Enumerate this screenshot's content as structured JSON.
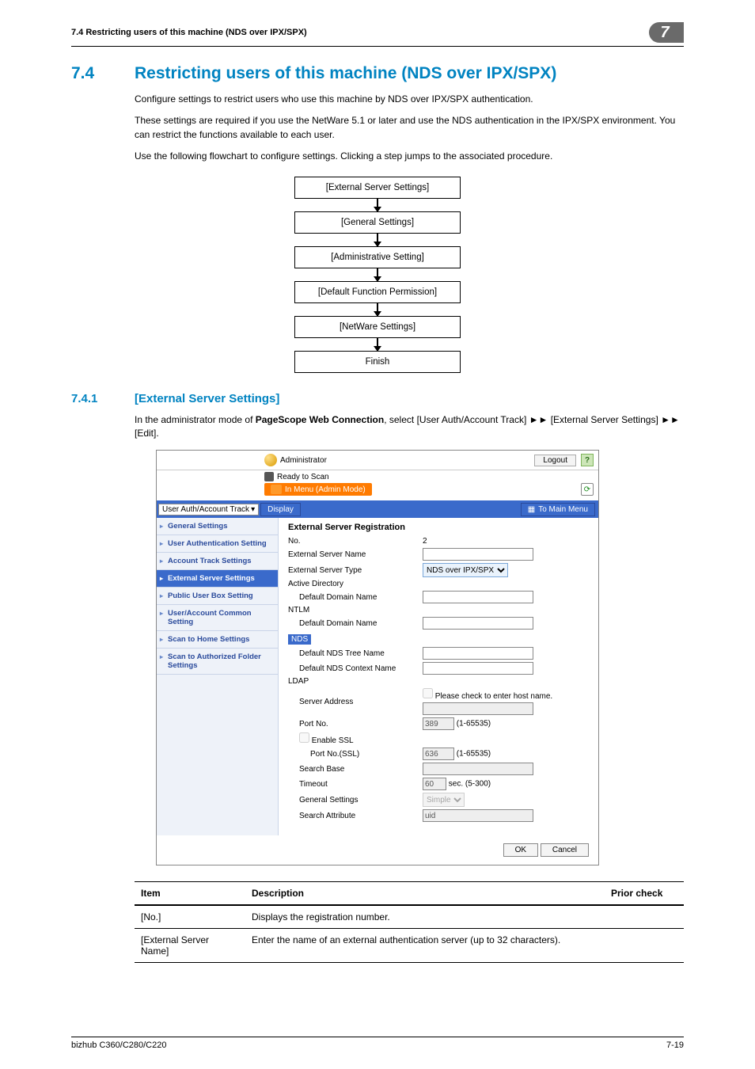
{
  "header": {
    "running": "7.4      Restricting users of this machine (NDS over IPX/SPX)",
    "chapter_badge": "7"
  },
  "title": {
    "num": "7.4",
    "text": "Restricting users of this machine (NDS over IPX/SPX)"
  },
  "paragraphs": {
    "p1": "Configure settings to restrict users who use this machine by NDS over IPX/SPX authentication.",
    "p2": "These settings are required if you use the NetWare 5.1 or later and use the NDS authentication in the IPX/SPX environment. You can restrict the functions available to each user.",
    "p3": "Use the following flowchart to configure settings. Clicking a step jumps to the associated procedure."
  },
  "flow": {
    "b1": "[External Server Settings]",
    "b2": "[General Settings]",
    "b3": "[Administrative Setting]",
    "b4": "[Default Function Permission]",
    "b5": "[NetWare Settings]",
    "b6": "Finish"
  },
  "subtitle": {
    "num": "7.4.1",
    "text": "[External Server Settings]"
  },
  "sub_p_prefix": "In the administrator mode of ",
  "sub_p_bold": "PageScope Web Connection",
  "sub_p_suffix": ", select [User Auth/Account Track] ►► [External Server Settings] ►► [Edit].",
  "screenshot": {
    "admin_label": "Administrator",
    "logout": "Logout",
    "ready": "Ready to Scan",
    "menu_mode": "In Menu (Admin Mode)",
    "dropdown": "User Auth/Account Track",
    "display_btn": "Display",
    "to_main": "To Main Menu",
    "side": {
      "s1": "General Settings",
      "s2": "User Authentication Setting",
      "s3": "Account Track Settings",
      "s4": "External Server Settings",
      "s5": "Public User Box Setting",
      "s6": "User/Account Common Setting",
      "s7": "Scan to Home Settings",
      "s8": "Scan to Authorized Folder Settings"
    },
    "content": {
      "heading": "External Server Registration",
      "no_label": "No.",
      "no_value": "2",
      "ext_name_label": "External Server Name",
      "ext_type_label": "External Server Type",
      "ext_type_value": "NDS over IPX/SPX",
      "ad_head": "Active Directory",
      "ad_domain": "Default Domain Name",
      "ntlm_head": "NTLM",
      "ntlm_domain": "Default Domain Name",
      "nds_head": "NDS",
      "nds_tree": "Default NDS Tree Name",
      "nds_ctx": "Default NDS Context Name",
      "ldap_head": "LDAP",
      "srv_addr": "Server Address",
      "srv_addr_cb": "Please check to enter host name.",
      "port_no": "Port No.",
      "port_no_v": "389",
      "port_range": "(1-65535)",
      "enable_ssl": "Enable SSL",
      "port_ssl": "Port No.(SSL)",
      "port_ssl_v": "636",
      "search_base": "Search Base",
      "timeout": "Timeout",
      "timeout_v": "60",
      "timeout_u": "sec. (5-300)",
      "gen_set": "General Settings",
      "gen_set_v": "Simple",
      "search_attr": "Search Attribute",
      "search_attr_v": "uid",
      "ok": "OK",
      "cancel": "Cancel"
    }
  },
  "table": {
    "h1": "Item",
    "h2": "Description",
    "h3": "Prior check",
    "r1c1": "[No.]",
    "r1c2": "Displays the registration number.",
    "r2c1": "[External Server Name]",
    "r2c2": "Enter the name of an external authentication server (up to 32 characters)."
  },
  "footer": {
    "left": "bizhub C360/C280/C220",
    "right": "7-19"
  }
}
